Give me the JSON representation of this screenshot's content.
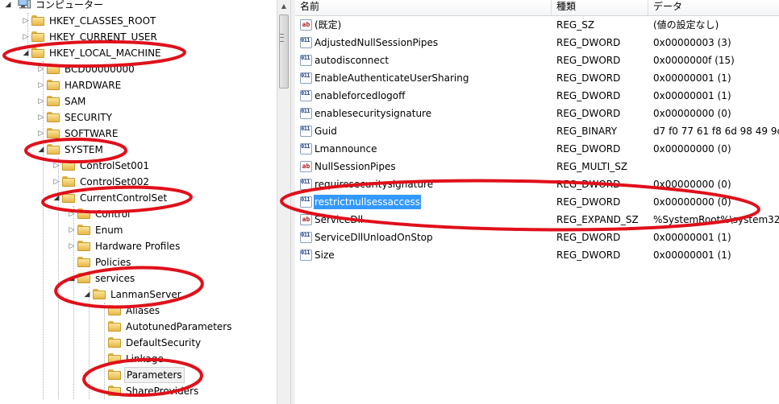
{
  "tree": {
    "root": "コンピューター",
    "nodes": [
      {
        "label": "HKEY_CLASSES_ROOT"
      },
      {
        "label": "HKEY_CURRENT_USER"
      },
      {
        "label": "HKEY_LOCAL_MACHINE"
      },
      {
        "label": "BCD00000000"
      },
      {
        "label": "HARDWARE"
      },
      {
        "label": "SAM"
      },
      {
        "label": "SECURITY"
      },
      {
        "label": "SOFTWARE"
      },
      {
        "label": "SYSTEM"
      },
      {
        "label": "ControlSet001"
      },
      {
        "label": "ControlSet002"
      },
      {
        "label": "CurrentControlSet"
      },
      {
        "label": "Control"
      },
      {
        "label": "Enum"
      },
      {
        "label": "Hardware Profiles"
      },
      {
        "label": "Policies"
      },
      {
        "label": "services"
      },
      {
        "label": "LanmanServer"
      },
      {
        "label": "Aliases"
      },
      {
        "label": "AutotunedParameters"
      },
      {
        "label": "DefaultSecurity"
      },
      {
        "label": "Linkage"
      },
      {
        "label": "Parameters"
      },
      {
        "label": "ShareProviders"
      }
    ]
  },
  "list": {
    "columns": {
      "name": "名前",
      "type": "種類",
      "data": "データ"
    },
    "rows": [
      {
        "icon": "string-value-icon",
        "name": "(既定)",
        "type": "REG_SZ",
        "data": "(値の設定なし)"
      },
      {
        "icon": "binary-value-icon",
        "name": "AdjustedNullSessionPipes",
        "type": "REG_DWORD",
        "data": "0x00000003 (3)"
      },
      {
        "icon": "binary-value-icon",
        "name": "autodisconnect",
        "type": "REG_DWORD",
        "data": "0x0000000f (15)"
      },
      {
        "icon": "binary-value-icon",
        "name": "EnableAuthenticateUserSharing",
        "type": "REG_DWORD",
        "data": "0x00000001 (1)"
      },
      {
        "icon": "binary-value-icon",
        "name": "enableforcedlogoff",
        "type": "REG_DWORD",
        "data": "0x00000001 (1)"
      },
      {
        "icon": "binary-value-icon",
        "name": "enablesecuritysignature",
        "type": "REG_DWORD",
        "data": "0x00000000 (0)"
      },
      {
        "icon": "binary-value-icon",
        "name": "Guid",
        "type": "REG_BINARY",
        "data": "d7 f0 77 61 f8 6d 98 49 9c"
      },
      {
        "icon": "binary-value-icon",
        "name": "Lmannounce",
        "type": "REG_DWORD",
        "data": "0x00000000 (0)"
      },
      {
        "icon": "string-value-icon",
        "name": "NullSessionPipes",
        "type": "REG_MULTI_SZ",
        "data": ""
      },
      {
        "icon": "binary-value-icon",
        "name": "requiresecuritysignature",
        "type": "REG_DWORD",
        "data": "0x00000000 (0)"
      },
      {
        "icon": "binary-value-icon",
        "name": "restrictnullsessaccess",
        "type": "REG_DWORD",
        "data": "0x00000000 (0)"
      },
      {
        "icon": "string-value-icon",
        "name": "ServiceDll",
        "type": "REG_EXPAND_SZ",
        "data": "%SystemRoot%\\system32"
      },
      {
        "icon": "binary-value-icon",
        "name": "ServiceDllUnloadOnStop",
        "type": "REG_DWORD",
        "data": "0x00000001 (1)"
      },
      {
        "icon": "binary-value-icon",
        "name": "Size",
        "type": "REG_DWORD",
        "data": "0x00000001 (1)"
      }
    ]
  },
  "colors": {
    "selection": "#3399ff",
    "annotation": "#e0101a",
    "folder": "#f2c94c"
  }
}
